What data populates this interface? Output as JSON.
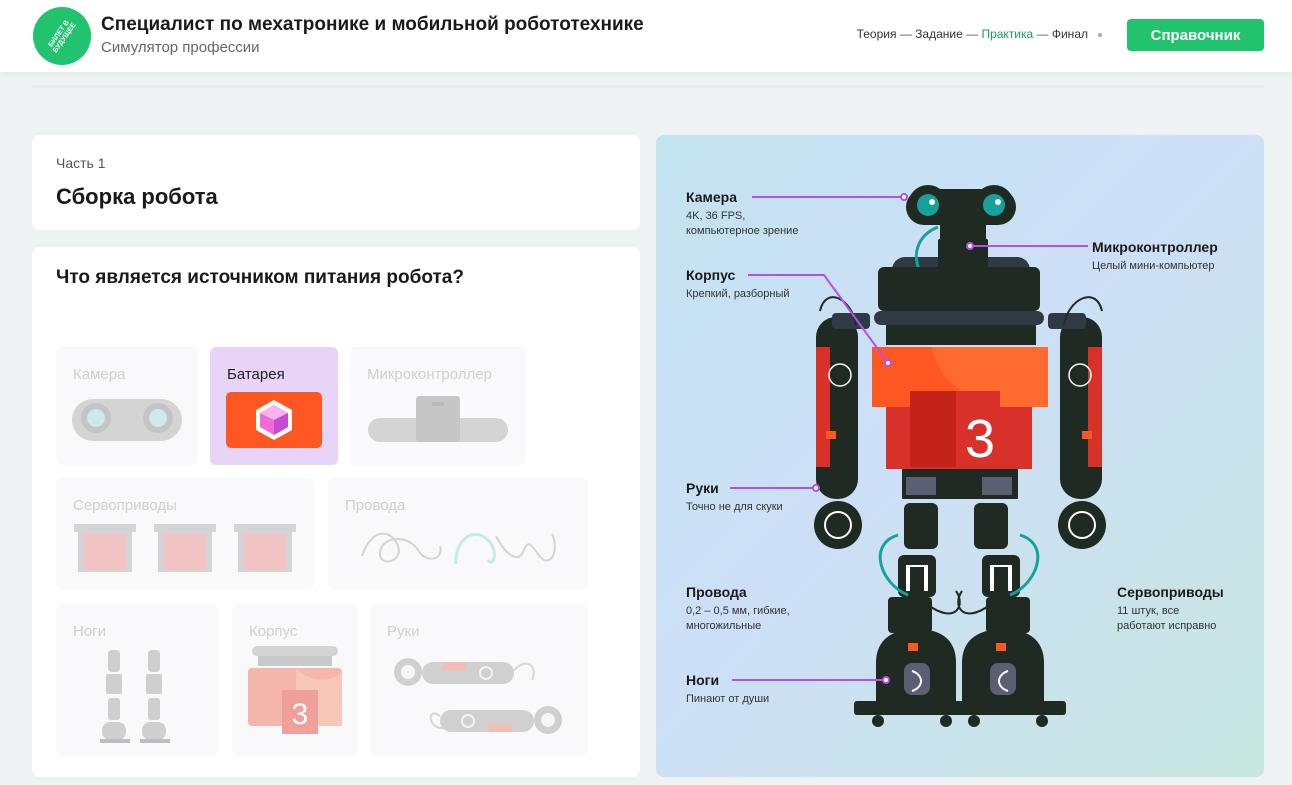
{
  "header": {
    "logo_text": "БИЛЕТ В БУДУЩЕЕ",
    "title": "Специалист по мехатронике и мобильной робототехнике",
    "subtitle": "Симулятор профессии",
    "steps": [
      "Теория",
      "Задание",
      "Практика",
      "Финал"
    ],
    "steps_separator": " — ",
    "active_step": "Практика",
    "reference_button": "Справочник"
  },
  "part": {
    "label": "Часть 1",
    "title": "Сборка робота"
  },
  "question": {
    "text": "Что является источником питания робота?",
    "options": [
      {
        "label": "Камера",
        "selected": false
      },
      {
        "label": "Батарея",
        "selected": true
      },
      {
        "label": "Микроконтроллер",
        "selected": false
      },
      {
        "label": "Сервоприводы",
        "selected": false
      },
      {
        "label": "Провода",
        "selected": false
      },
      {
        "label": "Ноги",
        "selected": false
      },
      {
        "label": "Корпус",
        "selected": false
      },
      {
        "label": "Руки",
        "selected": false
      }
    ]
  },
  "robot": {
    "body_number": "3",
    "labels": {
      "camera": {
        "title": "Камера",
        "desc": [
          "4K, 36 FPS,",
          "компьютерное зрение"
        ]
      },
      "microcontroller": {
        "title": "Микроконтроллер",
        "desc": [
          "Целый мини-компьютер"
        ]
      },
      "body": {
        "title": "Корпус",
        "desc": [
          "Крепкий, разборный"
        ]
      },
      "arms": {
        "title": "Руки",
        "desc": [
          "Точно не для скуки"
        ]
      },
      "wires": {
        "title": "Провода",
        "desc": [
          "0,2 – 0,5 мм, гибкие,",
          "многожильные"
        ]
      },
      "servos": {
        "title": "Сервоприводы",
        "desc": [
          "11 штук, все",
          "работают исправно"
        ]
      },
      "legs": {
        "title": "Ноги",
        "desc": [
          "Пинают от души"
        ]
      }
    }
  },
  "colors": {
    "brand_green": "#22c36f",
    "selected_option": "#e7d4f7",
    "robot_orange": "#ff5722",
    "robot_dark": "#1f2a22",
    "callout_purple": "#b44fe8"
  }
}
